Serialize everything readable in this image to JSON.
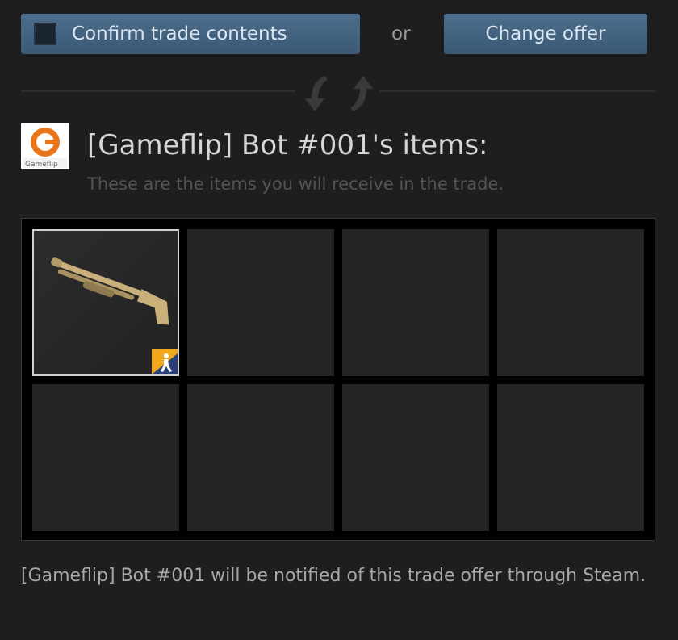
{
  "actions": {
    "confirm_label": "Confirm trade contents",
    "or_label": "or",
    "change_label": "Change offer"
  },
  "partner": {
    "avatar_text": "Gameflip",
    "title": "[Gameflip] Bot #001's items:",
    "subtitle": "These are the items you will receive in the trade."
  },
  "items": [
    {
      "slot": 1,
      "filled": true,
      "icon": "shotgun-item-icon",
      "game_icon": "counter-strike-icon"
    },
    {
      "slot": 2,
      "filled": false
    },
    {
      "slot": 3,
      "filled": false
    },
    {
      "slot": 4,
      "filled": false
    },
    {
      "slot": 5,
      "filled": false
    },
    {
      "slot": 6,
      "filled": false
    },
    {
      "slot": 7,
      "filled": false
    },
    {
      "slot": 8,
      "filled": false
    }
  ],
  "footer": {
    "notice": "[Gameflip] Bot #001 will be notified of this trade offer through Steam."
  },
  "colors": {
    "button_top": "#4d6e8c",
    "button_bottom": "#3a5876",
    "background": "#1e1e1e",
    "slot": "#252525"
  }
}
